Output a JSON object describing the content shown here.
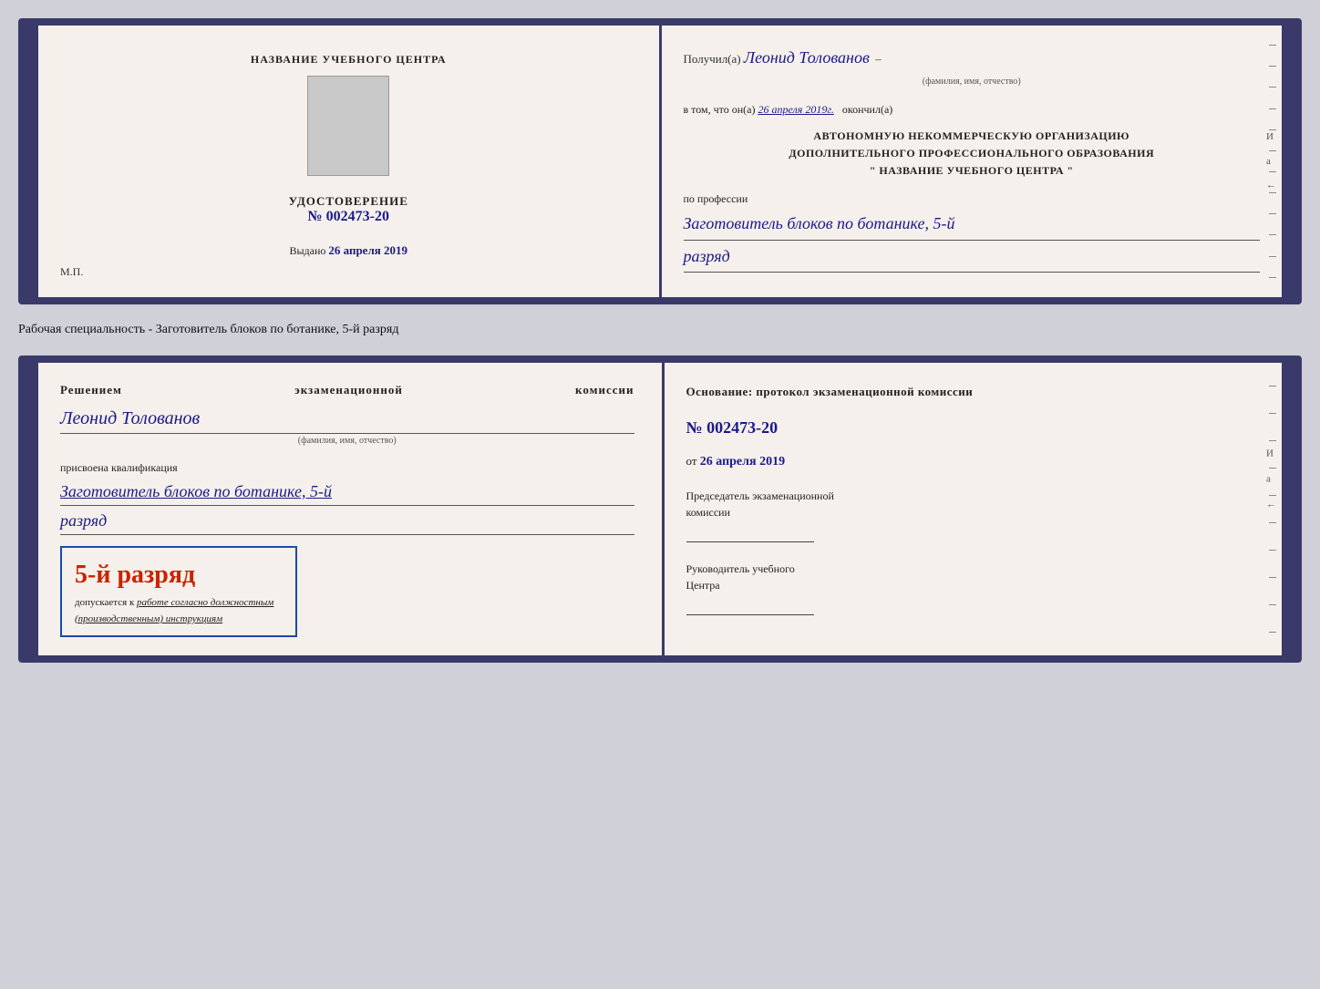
{
  "page": {
    "background_color": "#d0d0d8"
  },
  "caption": {
    "text": "Рабочая специальность - Заготовитель блоков по ботанике, 5-й разряд"
  },
  "doc1": {
    "left": {
      "header": "НАЗВАНИЕ УЧЕБНОГО ЦЕНТРА",
      "cert_title": "УДОСТОВЕРЕНИЕ",
      "cert_number": "№ 002473-20",
      "issued_label": "Выдано",
      "issued_date": "26 апреля 2019",
      "mp_label": "М.П."
    },
    "right": {
      "recipient_prefix": "Получил(а)",
      "recipient_name": "Леонид Толованов",
      "fio_label": "(фамилия, имя, отчество)",
      "in_that_label": "в том, что он(а)",
      "date_italic": "26 апреля 2019г.",
      "finished_label": "окончил(а)",
      "org_line1": "АВТОНОМНУЮ НЕКОММЕРЧЕСКУЮ ОРГАНИЗАЦИЮ",
      "org_line2": "ДОПОЛНИТЕЛЬНОГО ПРОФЕССИОНАЛЬНОГО ОБРАЗОВАНИЯ",
      "org_line3": "\"   НАЗВАНИЕ УЧЕБНОГО ЦЕНТРА   \"",
      "profession_label": "по профессии",
      "profession_value": "Заготовитель блоков по ботанике, 5-й",
      "razryad_value": "разряд"
    }
  },
  "doc2": {
    "left": {
      "komissia_line": "Решением экзаменационной комиссии",
      "person_name": "Леонид Толованов",
      "fio_label": "(фамилия, имя, отчество)",
      "assigned_text": "присвоена квалификация",
      "profession_value": "Заготовитель блоков по ботанике, 5-й",
      "razryad_value": "разряд",
      "badge_text": "5-й разряд",
      "dopuskaetsya": "допускается к",
      "work_text": "работе согласно должностным",
      "instructions_text": "(производственным) инструкциям"
    },
    "right": {
      "osnov_label": "Основание: протокол экзаменационной комиссии",
      "protocol_number": "№  002473-20",
      "from_prefix": "от",
      "from_date": "26 апреля 2019",
      "chairman_label": "Председатель экзаменационной",
      "chairman_label2": "комиссии",
      "director_label": "Руководитель учебного",
      "director_label2": "Центра"
    }
  }
}
